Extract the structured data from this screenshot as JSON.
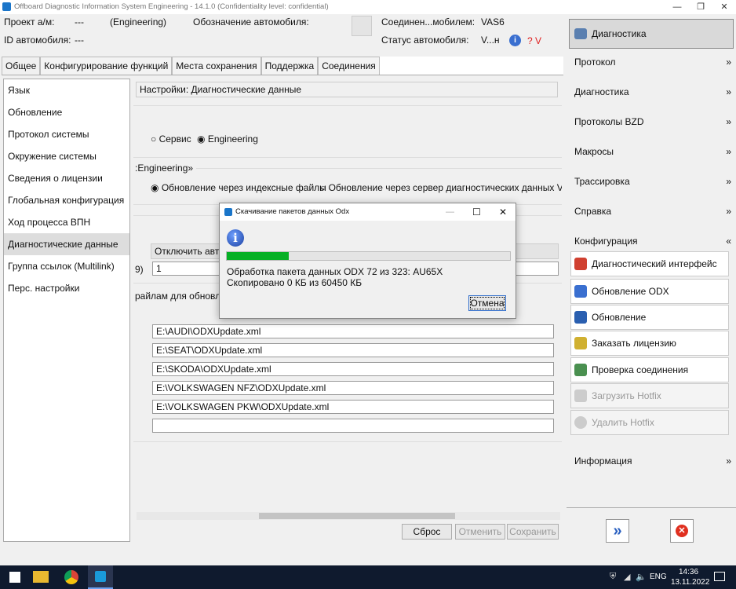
{
  "window": {
    "title": "Offboard Diagnostic Information System Engineering - 14.1.0 (Confidentiality level: confidential)",
    "controls": [
      "—",
      "❐",
      "✕"
    ]
  },
  "header": {
    "project_label": "Проект а/м:",
    "project_value": "---",
    "mode": "(Engineering)",
    "designation_label": "Обозначение автомобиля:",
    "vehicle_id_label": "ID автомобиля:",
    "vehicle_id_value": "---",
    "connected_label": "Соединен...мобилем:",
    "connected_value": "VAS6",
    "status_label": "Статус автомобиля:",
    "status_value": "V...н",
    "status_flag": "? V"
  },
  "tabs": [
    "Общее",
    "Конфигурирование функций",
    "Места сохранения",
    "Поддержка",
    "Соединения"
  ],
  "nav": [
    "Язык",
    "Обновление",
    "Протокол системы",
    "Окружение системы",
    "Сведения о лицензии",
    "Глобальная конфигурация",
    "Ход процесса ВПН",
    "Диагностические данные",
    "Группа ссылок (Multilink)",
    "Перс. настройки"
  ],
  "content": {
    "settings_title": "Настройки: Диагностические данные",
    "radio_service": "Сервис",
    "radio_engineering": "Engineering",
    "group_label": ":Engineering»",
    "radio_index": "Обновление через индексные файлы",
    "radio_server": "Обновление через сервер диагностических данных Vo",
    "disable_header": "Отключить авто",
    "field_label": "9)",
    "field_value": "1",
    "paths_label": "райлам для обновле",
    "paths": [
      "E:\\AUDI\\ODXUpdate.xml",
      "E:\\SEAT\\ODXUpdate.xml",
      "E:\\SKODA\\ODXUpdate.xml",
      "E:\\VOLKSWAGEN NFZ\\ODXUpdate.xml",
      "E:\\VOLKSWAGEN PKW\\ODXUpdate.xml",
      ""
    ],
    "reset": "Сброс",
    "cancel": "Отменить",
    "save": "Сохранить"
  },
  "dialog": {
    "title": "Скачивание пакетов данных Odx",
    "progress": 0.22,
    "line1": "Обработка пакета данных ODX 72 из 323: AU65X",
    "line2": "Скопировано 0 КБ из 60450 КБ",
    "cancel": "Отмена"
  },
  "right": {
    "diagnostics": "Диагностика",
    "sections": [
      "Протокол",
      "Диагностика",
      "Протоколы BZD",
      "Макросы",
      "Трассировка",
      "Справка",
      "Конфигурация"
    ],
    "buttons": [
      "Диагностический интерфейс",
      "Обновление ODX",
      "Обновление",
      "Заказать лицензию",
      "Проверка соединения",
      "Загрузить Hotfix",
      "Удалить Hotfix"
    ],
    "info": "Информация"
  },
  "taskbar": {
    "lang": "ENG",
    "time": "14:36",
    "date": "13.11.2022"
  },
  "colors": {
    "progress": "#06b025",
    "accent": "#1a75c9"
  }
}
